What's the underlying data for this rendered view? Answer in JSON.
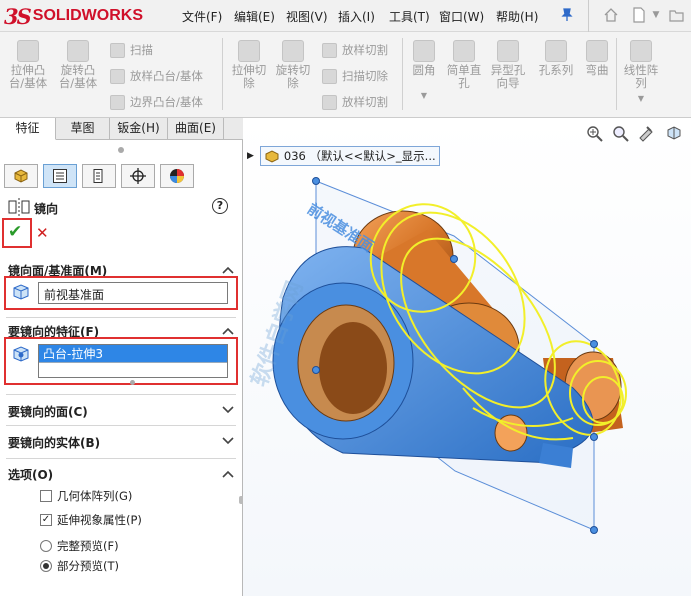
{
  "app": {
    "logo_ds": "3S",
    "logo_text": "SOLIDWORKS"
  },
  "menu": [
    "文件(F)",
    "编辑(E)",
    "视图(V)",
    "插入(I)",
    "工具(T)",
    "窗口(W)",
    "帮助(H)"
  ],
  "titlebar_icons": [
    "pin-icon",
    "home-icon",
    "new-doc-icon"
  ],
  "ribbon": {
    "big_buttons": [
      "拉伸凸\n台/基体",
      "旋转凸\n台/基体",
      "拉伸切\n除",
      "旋转切\n除",
      "圆角",
      "简单直\n孔",
      "异型孔\n向导",
      "孔系列",
      "弯曲",
      "线性阵\n列"
    ],
    "small_buttons": [
      "扫描",
      "放样凸台/基体",
      "边界凸台/基体",
      "放样切割",
      "扫描切除",
      "放样切割"
    ]
  },
  "tabs": [
    "特征",
    "草图",
    "钣金(H)",
    "曲面(E)"
  ],
  "panel_tab_icons": [
    "feature-manager-icon",
    "property-manager-icon",
    "configuration-manager-icon",
    "dimxpert-icon",
    "display-manager-icon"
  ],
  "property": {
    "title": "镜向",
    "help": "?",
    "ok": "✔",
    "cancel": "✕",
    "mirror_plane": {
      "header": "镜向面/基准面(M)",
      "value": "前视基准面"
    },
    "features": {
      "header": "要镜向的特征(F)",
      "value": "凸台-拉伸3"
    },
    "faces": {
      "header": "要镜向的面(C)"
    },
    "bodies": {
      "header": "要镜向的实体(B)"
    },
    "options": {
      "header": "选项(O)",
      "geometry_pattern": {
        "label": "几何体阵列(G)",
        "checked": false
      },
      "propagate_visual": {
        "label": "延伸视象属性(P)",
        "checked": true
      },
      "full_preview": {
        "label": "完整预览(F)",
        "selected": false
      },
      "partial_preview": {
        "label": "部分预览(T)",
        "selected": true
      }
    }
  },
  "viewport": {
    "tree_label": "036 （默认<<默认>_显示...",
    "plane_label": "前视基准面",
    "view_icons": [
      "zoom-fit-icon",
      "zoom-area-icon",
      "previous-view-icon",
      "section-view-icon"
    ]
  },
  "colors": {
    "accent": "#2e6ac9",
    "part_orange": "#d8772a",
    "preview_yellow": "#f2ef2a",
    "selection_blue": "#4a8fe0",
    "highlight": "#e03030"
  }
}
